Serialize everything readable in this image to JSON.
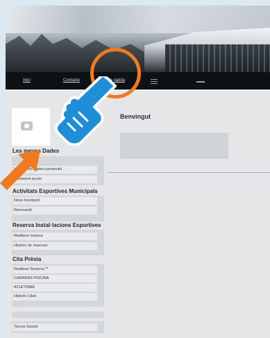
{
  "nav": {
    "items": [
      {
        "label": "Inici"
      },
      {
        "label": "Contacte"
      },
      {
        "label": "Guia rapida"
      }
    ]
  },
  "main": {
    "welcome_title": "Benvingut"
  },
  "sidebar": {
    "sections": [
      {
        "title": "Les meves Dades",
        "items": [
          {
            "label": "Les meves Dades personals"
          },
          {
            "label": "Password accés"
          }
        ]
      },
      {
        "title": "Activitats Esportives Municipals",
        "items": [
          {
            "label": "Nova Inscripció"
          },
          {
            "label": "Renovació"
          }
        ]
      },
      {
        "title": "Reserva Instal·lacions Esportives",
        "items": [
          {
            "label": "Realitzar reserva"
          },
          {
            "label": "Històric de reserves"
          }
        ]
      },
      {
        "title": "Cita Prèvia",
        "items": [
          {
            "label": "Realitzar Reserva **"
          },
          {
            "label": "CARRERS PISCINA"
          },
          {
            "label": "ATLETISME"
          },
          {
            "label": "Historic Cites"
          }
        ]
      }
    ],
    "logout_label": "Tancar Sessió"
  },
  "colors": {
    "accent": "#f07a22",
    "pointer": "#1e8fd6"
  },
  "icons": [
    "menu-icon",
    "camera-icon",
    "pointer-hand-icon",
    "arrow-icon"
  ]
}
